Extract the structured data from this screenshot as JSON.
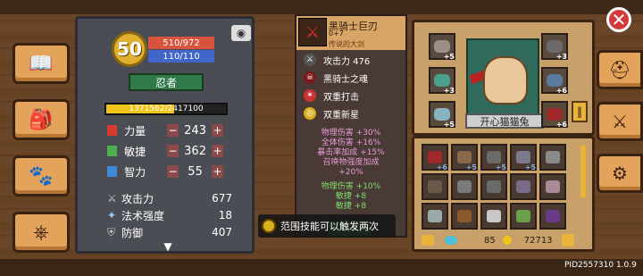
{
  "window": {
    "close_label": "✕",
    "build": "PID2557310 1.0.9"
  },
  "left_tabs": [
    {
      "icon": "book-icon",
      "glyph": "📖"
    },
    {
      "icon": "backpack-icon",
      "glyph": "🎒"
    },
    {
      "icon": "paw-icon",
      "glyph": "🐾"
    },
    {
      "icon": "steering-wheel-icon",
      "glyph": "⎈"
    }
  ],
  "right_tabs": [
    {
      "icon": "helmet-icon",
      "glyph": "⛑"
    },
    {
      "icon": "crossed-swords-icon",
      "glyph": "⚔"
    },
    {
      "icon": "gear-icon",
      "glyph": "⚙"
    }
  ],
  "character": {
    "level": "50",
    "hp": "510/972",
    "mp": "110/110",
    "class_name": "忍者",
    "xp": "1371562/2417100",
    "xp_fraction": 0.567,
    "attributes": [
      {
        "name": "力量",
        "value": "243",
        "color": "#d83b2d"
      },
      {
        "name": "敏捷",
        "value": "362",
        "color": "#4caf50"
      },
      {
        "name": "智力",
        "value": "55",
        "color": "#3f8ad8"
      }
    ],
    "derived": [
      {
        "name": "攻击力",
        "value": "677"
      },
      {
        "name": "法术强度",
        "value": "18"
      },
      {
        "name": "防御",
        "value": "407"
      }
    ]
  },
  "item": {
    "name": "黑骑士巨刃",
    "plus": "0+7",
    "rarity": "传说的大剑",
    "attack": "攻击力 476",
    "skills": [
      "黑骑士之魂",
      "双重打击",
      "双重新星"
    ],
    "bonus_pink": [
      "物理伤害 +30%",
      "全体伤害 +16%",
      "暴击率加成 +15%",
      "召唤物强度加成",
      "+20%"
    ],
    "bonus_green": [
      "物理伤害 +10%",
      "敏捷 +8",
      "敏捷 +8"
    ]
  },
  "tooltip": {
    "text": "范围技能可以触发两次"
  },
  "equipment": {
    "pet_name": "开心猫猫兔",
    "slots_left": [
      "+5",
      "+3",
      "+5"
    ],
    "slots_right": [
      "+3",
      "+6",
      "+6"
    ]
  },
  "inventory": {
    "row1": [
      "+6",
      "+5",
      "+5",
      "+5",
      ""
    ],
    "gems": "85",
    "gold": "72713"
  }
}
